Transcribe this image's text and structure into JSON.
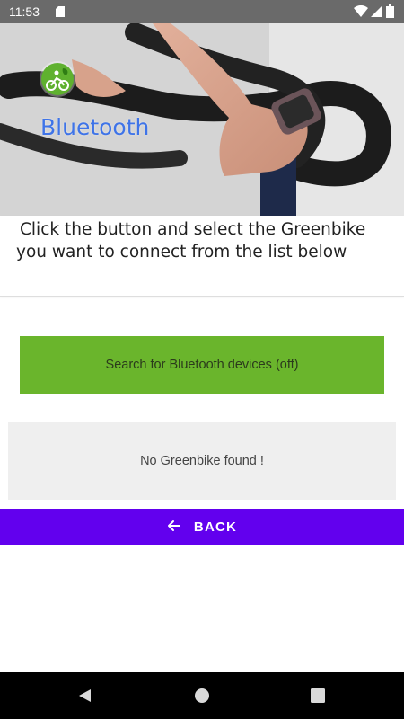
{
  "status_bar": {
    "time": "11:53",
    "icons": [
      "sd-card-icon",
      "wifi-icon",
      "signal-icon",
      "battery-icon"
    ]
  },
  "header": {
    "title": "Bluetooth",
    "logo_icon": "bike-leaf-logo-icon",
    "title_color": "#3f74e8"
  },
  "instruction": {
    "text": "Click the button and select the Greenbike you want to connect from the list below"
  },
  "search_button": {
    "label": "Search for Bluetooth devices (off)",
    "color": "#6ab52c"
  },
  "results": {
    "empty_text": "No Greenbike found !"
  },
  "back_button": {
    "label": "BACK",
    "icon": "arrow-left-icon",
    "color": "#6200ee"
  },
  "nav_bar": {
    "icons": [
      "nav-back-icon",
      "nav-home-icon",
      "nav-recents-icon"
    ]
  }
}
